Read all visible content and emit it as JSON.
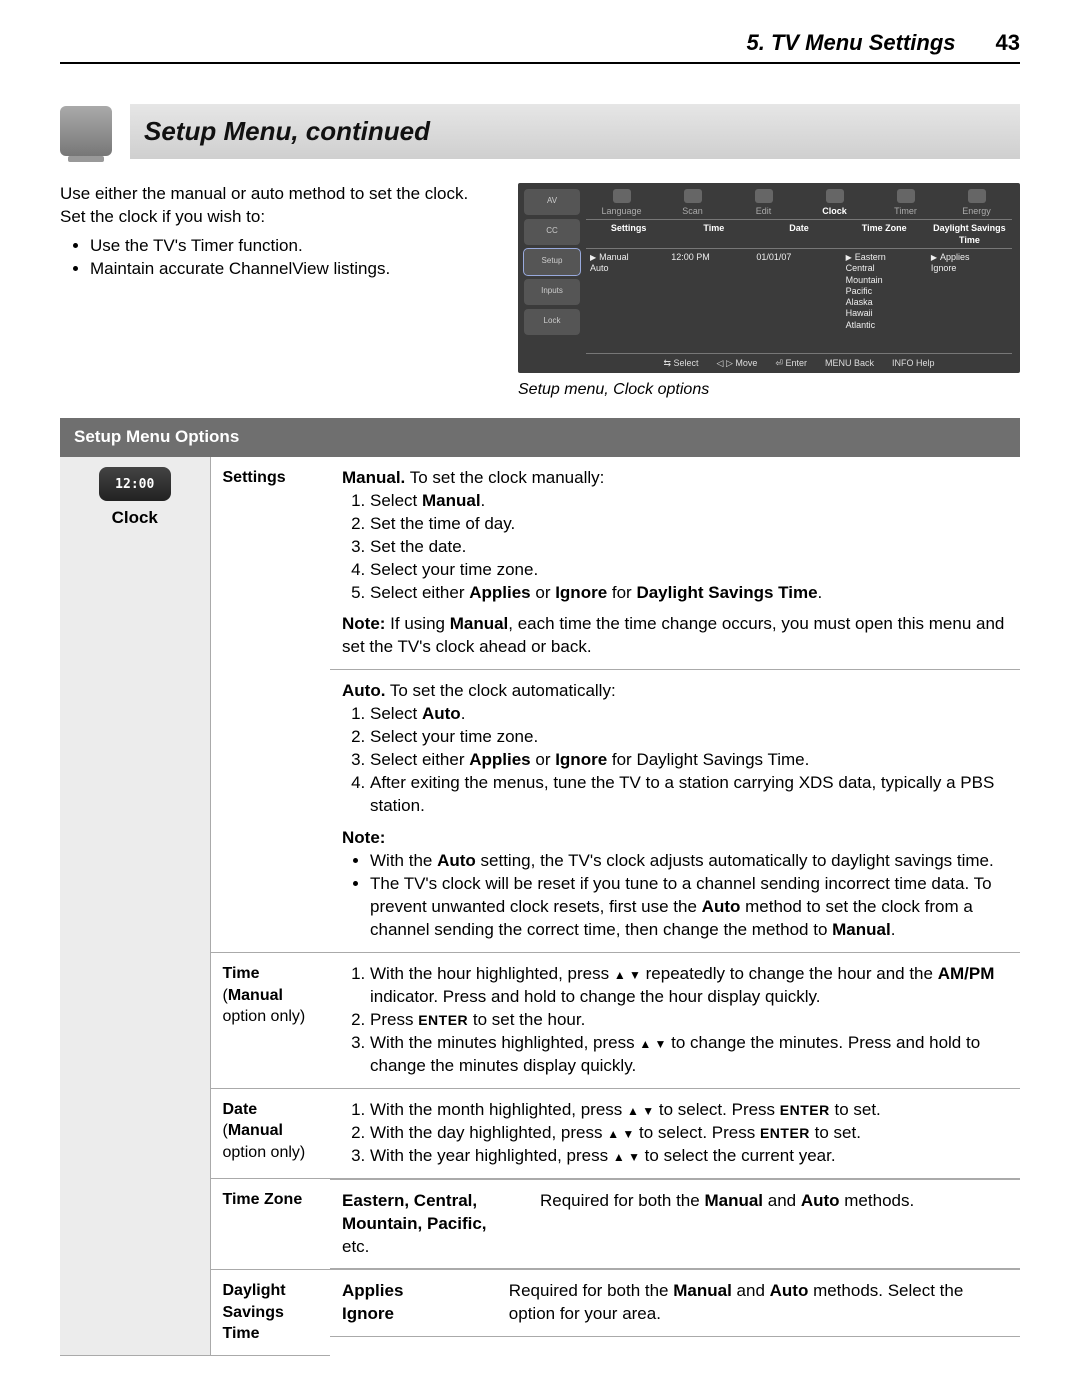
{
  "header": {
    "chapter": "5.  TV Menu Settings",
    "page": "43"
  },
  "section_title": "Setup Menu, continued",
  "intro": {
    "p1": "Use either the manual or auto method to set the clock. Set the clock if you wish to:",
    "b1": "Use the TV's Timer function.",
    "b2": "Maintain accurate ChannelView listings."
  },
  "osd": {
    "tabs": [
      "Language",
      "Scan",
      "Edit",
      "Clock",
      "Timer",
      "Energy"
    ],
    "cols": [
      "Settings",
      "Time",
      "Date",
      "Time Zone",
      "Daylight Savings Time"
    ],
    "settings": [
      "Manual",
      "Auto"
    ],
    "time": "12:00 PM",
    "date": "01/01/07",
    "zones": [
      "Eastern",
      "Central",
      "Mountain",
      "Pacific",
      "Alaska",
      "Hawaii",
      "Atlantic"
    ],
    "dst": [
      "Applies",
      "Ignore"
    ],
    "leftnav": [
      "AV",
      "CC",
      "Setup",
      "Inputs",
      "Lock"
    ],
    "footer": [
      "⇆ Select",
      "◁ ▷ Move",
      "⏎ Enter",
      "MENU Back",
      "INFO Help"
    ]
  },
  "caption": "Setup menu, Clock options",
  "options_header": "Setup Menu Options",
  "side_label": "Clock",
  "clock_disp": "12:00",
  "rows": {
    "settings": {
      "label": "Settings",
      "manual_lead": "  To set the clock manually:",
      "manual_bold": "Manual.",
      "m1_pre": "Select ",
      "m1_b": "Manual",
      "m1_post": ".",
      "m2": "Set the time of day.",
      "m3": "Set the date.",
      "m4": "Select your time zone.",
      "m5_pre": "Select either ",
      "m5_b1": "Applies",
      "m5_mid": " or ",
      "m5_b2": "Ignore",
      "m5_mid2": " for ",
      "m5_b3": "Daylight Savings Time",
      "m5_post": ".",
      "note_b": "Note:",
      "note_pre": "  If using ",
      "note_man": "Manual",
      "note_post": ", each time the time change occurs, you must open this menu and set the TV's clock ahead or back.",
      "auto_bold": "Auto.",
      "auto_lead": "   To set the clock automatically:",
      "a1_pre": "Select ",
      "a1_b": "Auto",
      "a1_post": ".",
      "a2": "Select your time zone.",
      "a3_pre": "Select either ",
      "a3_b1": "Applies",
      "a3_mid": " or ",
      "a3_b2": "Ignore",
      "a3_post": " for Daylight Savings Time.",
      "a4": "After exiting the menus, tune the TV to a station carrying XDS data, typically a PBS station.",
      "note2_h": "Note:",
      "note2_1_pre": "With the ",
      "note2_1_b": "Auto",
      "note2_1_post": " setting, the TV's clock adjusts automatically to daylight savings time.",
      "note2_2_pre": "The TV's clock will be reset if you tune to a channel sending incorrect time data.  To prevent unwanted clock resets, first use the ",
      "note2_2_b": "Auto",
      "note2_2_mid": " method to set the clock from a channel sending the correct time, then change the method to ",
      "note2_2_b2": "Manual",
      "note2_2_post": "."
    },
    "time": {
      "label_b": "Time",
      "label_paren": "(",
      "label_paren_b": "Manual",
      "label_paren_rest": " option only)",
      "t1_pre": "With the hour highlighted, press ",
      "t1_mid": " repeatedly to change the hour and the ",
      "t1_b": "AM/PM",
      "t1_post": " indicator.  Press and hold to change the hour display quickly.",
      "t2_pre": " Press ",
      "t2_enter": "ENTER",
      "t2_post": " to set the hour.",
      "t3_pre": "With the minutes highlighted, press ",
      "t3_post": " to change the minutes.  Press and hold to change the minutes display quickly."
    },
    "date": {
      "label_b": "Date",
      "d1_pre": "With the month highlighted, press ",
      "d1_mid": " to select.  Press ",
      "d1_enter": "ENTER",
      "d1_post": " to set.",
      "d2_pre": "With the day highlighted, press ",
      "d2_mid": " to select.  Press ",
      "d2_enter": "ENTER",
      "d2_post": " to set.",
      "d3_pre": "With the year highlighted, press ",
      "d3_post": " to select the current year."
    },
    "tz": {
      "label": "Time Zone",
      "list": "Eastern, Central, Mountain, Pacific,",
      "list_etc": " etc.",
      "desc_pre": "Required for both the ",
      "desc_b1": "Manual",
      "desc_mid": " and ",
      "desc_b2": "Auto",
      "desc_post": " methods."
    },
    "dst": {
      "label": "Daylight Savings Time",
      "opts_b1": "Applies",
      "opts_b2": "Ignore",
      "desc_pre": "Required for both the ",
      "desc_b1": "Manual",
      "desc_mid": " and ",
      "desc_b2": "Auto",
      "desc_post": " methods.  Select the option for your area."
    }
  }
}
